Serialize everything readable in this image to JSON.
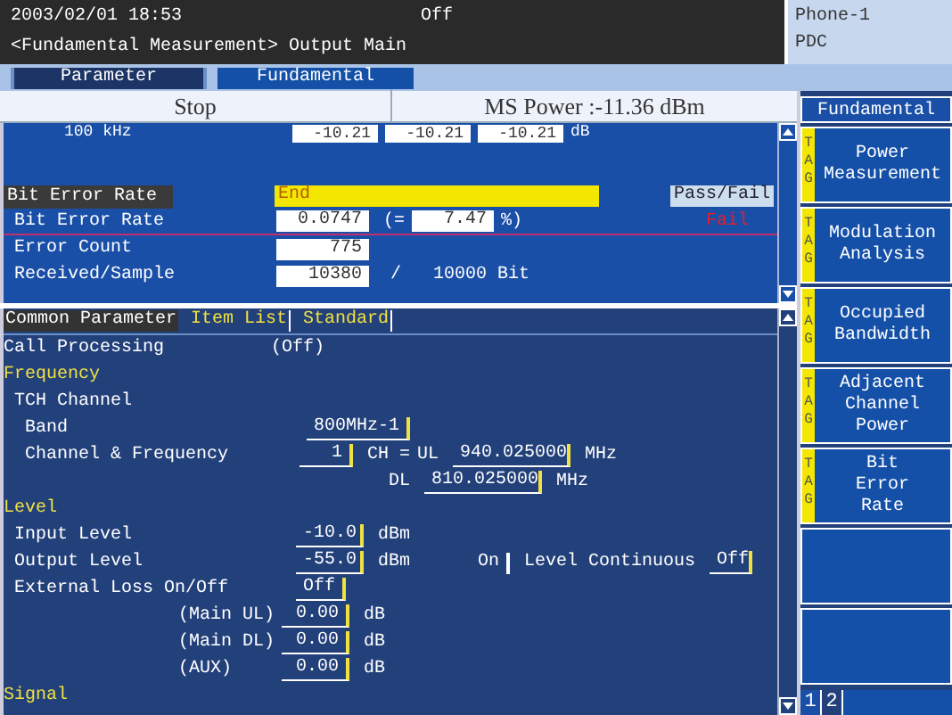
{
  "header": {
    "datetime": "2003/02/01 18:53",
    "state": "Off",
    "title": "<Fundamental Measurement> Output Main"
  },
  "terminal": {
    "name": "Phone-1",
    "system": "PDC"
  },
  "tabs": [
    {
      "label": "Parameter",
      "selected": false
    },
    {
      "label": "Fundamental",
      "selected": true
    }
  ],
  "status": {
    "state": "Stop",
    "reading": "MS Power :-11.36 dBm"
  },
  "result_panel": {
    "partial_row": {
      "label": "100 kHz",
      "values": [
        "-10.21",
        "-10.21",
        "-10.21"
      ],
      "unit": "dB"
    },
    "section": {
      "label": "Bit Error Rate",
      "value": "End",
      "button": "Pass/Fail"
    },
    "rows": [
      {
        "kind": "ratio",
        "label": "Bit Error Rate",
        "value": "0.0747",
        "open": "(=",
        "value_2": "7.47",
        "close": "%)",
        "judgement": "Fail"
      },
      {
        "kind": "value",
        "label": "Error Count",
        "value": "775"
      },
      {
        "kind": "sample",
        "label": "Received/Sample",
        "value": "10380",
        "sep": "/",
        "total": "10000 Bit"
      }
    ]
  },
  "parameter_panel": {
    "tabs": [
      {
        "label": "Common Parameter",
        "selected": true
      },
      {
        "label": "Item List",
        "selected": false
      },
      {
        "label": "Standard",
        "selected": false
      }
    ],
    "items": [
      {
        "kind": "text",
        "label": "Call Processing",
        "value": "(Off)"
      },
      {
        "kind": "group",
        "label": "Frequency",
        "children": [
          {
            "kind": "group",
            "label": "TCH Channel",
            "children": [
              {
                "kind": "field",
                "label": "Band",
                "value": "800MHz-1"
              },
              {
                "kind": "channel",
                "label": "Channel & Frequency",
                "value": "1",
                "unit": "CH =",
                "ul_label": "UL",
                "ul": "940.025000",
                "ul_unit": "MHz",
                "dl_label": "DL",
                "dl": "810.025000",
                "dl_unit": "MHz"
              }
            ]
          }
        ]
      },
      {
        "kind": "group",
        "label": "Level",
        "children": [
          {
            "kind": "field",
            "label": "Input Level",
            "value": "-10.0",
            "unit": "dBm"
          },
          {
            "kind": "output",
            "label": "Output Level",
            "value": "-55.0",
            "unit": "dBm",
            "button": "On",
            "extra_label": "Level Continuous",
            "extra_value": "Off"
          },
          {
            "kind": "field",
            "label": "External Loss On/Off",
            "value": "Off"
          },
          {
            "kind": "loss",
            "label": "(Main UL)",
            "value": "0.00",
            "unit": "dB"
          },
          {
            "kind": "loss",
            "label": "(Main DL)",
            "value": "0.00",
            "unit": "dB"
          },
          {
            "kind": "loss",
            "label": "(AUX)",
            "value": "0.00",
            "unit": "dB"
          }
        ]
      },
      {
        "kind": "group",
        "label": "Signal"
      }
    ]
  },
  "softkeys": {
    "title": "Fundamental",
    "keys": [
      {
        "kind": "function",
        "tag": "TAG",
        "lines": [
          "Power",
          "Measurement"
        ]
      },
      {
        "kind": "function",
        "tag": "TAG",
        "lines": [
          "Modulation",
          "Analysis"
        ]
      },
      {
        "kind": "function",
        "tag": "TAG",
        "lines": [
          "Occupied",
          "Bandwidth"
        ]
      },
      {
        "kind": "function",
        "tag": "TAG",
        "lines": [
          "Adjacent",
          "Channel",
          "Power"
        ]
      },
      {
        "kind": "function",
        "tag": "TAG",
        "lines": [
          "Bit",
          "Error",
          "Rate"
        ]
      },
      {
        "kind": "blank"
      },
      {
        "kind": "blank"
      }
    ],
    "pages": [
      {
        "label": "1",
        "selected": true
      },
      {
        "label": "2",
        "selected": false
      }
    ]
  }
}
